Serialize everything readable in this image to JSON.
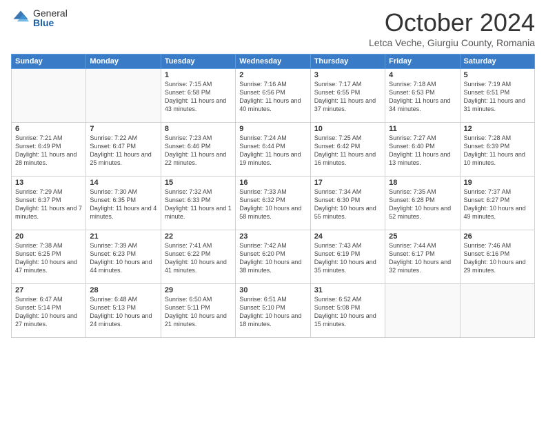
{
  "logo": {
    "general": "General",
    "blue": "Blue",
    "icon_color": "#1a5fa8"
  },
  "header": {
    "title": "October 2024",
    "location": "Letca Veche, Giurgiu County, Romania"
  },
  "weekdays": [
    "Sunday",
    "Monday",
    "Tuesday",
    "Wednesday",
    "Thursday",
    "Friday",
    "Saturday"
  ],
  "weeks": [
    [
      {
        "day": "",
        "sunrise": "",
        "sunset": "",
        "daylight": ""
      },
      {
        "day": "",
        "sunrise": "",
        "sunset": "",
        "daylight": ""
      },
      {
        "day": "1",
        "sunrise": "Sunrise: 7:15 AM",
        "sunset": "Sunset: 6:58 PM",
        "daylight": "Daylight: 11 hours and 43 minutes."
      },
      {
        "day": "2",
        "sunrise": "Sunrise: 7:16 AM",
        "sunset": "Sunset: 6:56 PM",
        "daylight": "Daylight: 11 hours and 40 minutes."
      },
      {
        "day": "3",
        "sunrise": "Sunrise: 7:17 AM",
        "sunset": "Sunset: 6:55 PM",
        "daylight": "Daylight: 11 hours and 37 minutes."
      },
      {
        "day": "4",
        "sunrise": "Sunrise: 7:18 AM",
        "sunset": "Sunset: 6:53 PM",
        "daylight": "Daylight: 11 hours and 34 minutes."
      },
      {
        "day": "5",
        "sunrise": "Sunrise: 7:19 AM",
        "sunset": "Sunset: 6:51 PM",
        "daylight": "Daylight: 11 hours and 31 minutes."
      }
    ],
    [
      {
        "day": "6",
        "sunrise": "Sunrise: 7:21 AM",
        "sunset": "Sunset: 6:49 PM",
        "daylight": "Daylight: 11 hours and 28 minutes."
      },
      {
        "day": "7",
        "sunrise": "Sunrise: 7:22 AM",
        "sunset": "Sunset: 6:47 PM",
        "daylight": "Daylight: 11 hours and 25 minutes."
      },
      {
        "day": "8",
        "sunrise": "Sunrise: 7:23 AM",
        "sunset": "Sunset: 6:46 PM",
        "daylight": "Daylight: 11 hours and 22 minutes."
      },
      {
        "day": "9",
        "sunrise": "Sunrise: 7:24 AM",
        "sunset": "Sunset: 6:44 PM",
        "daylight": "Daylight: 11 hours and 19 minutes."
      },
      {
        "day": "10",
        "sunrise": "Sunrise: 7:25 AM",
        "sunset": "Sunset: 6:42 PM",
        "daylight": "Daylight: 11 hours and 16 minutes."
      },
      {
        "day": "11",
        "sunrise": "Sunrise: 7:27 AM",
        "sunset": "Sunset: 6:40 PM",
        "daylight": "Daylight: 11 hours and 13 minutes."
      },
      {
        "day": "12",
        "sunrise": "Sunrise: 7:28 AM",
        "sunset": "Sunset: 6:39 PM",
        "daylight": "Daylight: 11 hours and 10 minutes."
      }
    ],
    [
      {
        "day": "13",
        "sunrise": "Sunrise: 7:29 AM",
        "sunset": "Sunset: 6:37 PM",
        "daylight": "Daylight: 11 hours and 7 minutes."
      },
      {
        "day": "14",
        "sunrise": "Sunrise: 7:30 AM",
        "sunset": "Sunset: 6:35 PM",
        "daylight": "Daylight: 11 hours and 4 minutes."
      },
      {
        "day": "15",
        "sunrise": "Sunrise: 7:32 AM",
        "sunset": "Sunset: 6:33 PM",
        "daylight": "Daylight: 11 hours and 1 minute."
      },
      {
        "day": "16",
        "sunrise": "Sunrise: 7:33 AM",
        "sunset": "Sunset: 6:32 PM",
        "daylight": "Daylight: 10 hours and 58 minutes."
      },
      {
        "day": "17",
        "sunrise": "Sunrise: 7:34 AM",
        "sunset": "Sunset: 6:30 PM",
        "daylight": "Daylight: 10 hours and 55 minutes."
      },
      {
        "day": "18",
        "sunrise": "Sunrise: 7:35 AM",
        "sunset": "Sunset: 6:28 PM",
        "daylight": "Daylight: 10 hours and 52 minutes."
      },
      {
        "day": "19",
        "sunrise": "Sunrise: 7:37 AM",
        "sunset": "Sunset: 6:27 PM",
        "daylight": "Daylight: 10 hours and 49 minutes."
      }
    ],
    [
      {
        "day": "20",
        "sunrise": "Sunrise: 7:38 AM",
        "sunset": "Sunset: 6:25 PM",
        "daylight": "Daylight: 10 hours and 47 minutes."
      },
      {
        "day": "21",
        "sunrise": "Sunrise: 7:39 AM",
        "sunset": "Sunset: 6:23 PM",
        "daylight": "Daylight: 10 hours and 44 minutes."
      },
      {
        "day": "22",
        "sunrise": "Sunrise: 7:41 AM",
        "sunset": "Sunset: 6:22 PM",
        "daylight": "Daylight: 10 hours and 41 minutes."
      },
      {
        "day": "23",
        "sunrise": "Sunrise: 7:42 AM",
        "sunset": "Sunset: 6:20 PM",
        "daylight": "Daylight: 10 hours and 38 minutes."
      },
      {
        "day": "24",
        "sunrise": "Sunrise: 7:43 AM",
        "sunset": "Sunset: 6:19 PM",
        "daylight": "Daylight: 10 hours and 35 minutes."
      },
      {
        "day": "25",
        "sunrise": "Sunrise: 7:44 AM",
        "sunset": "Sunset: 6:17 PM",
        "daylight": "Daylight: 10 hours and 32 minutes."
      },
      {
        "day": "26",
        "sunrise": "Sunrise: 7:46 AM",
        "sunset": "Sunset: 6:16 PM",
        "daylight": "Daylight: 10 hours and 29 minutes."
      }
    ],
    [
      {
        "day": "27",
        "sunrise": "Sunrise: 6:47 AM",
        "sunset": "Sunset: 5:14 PM",
        "daylight": "Daylight: 10 hours and 27 minutes."
      },
      {
        "day": "28",
        "sunrise": "Sunrise: 6:48 AM",
        "sunset": "Sunset: 5:13 PM",
        "daylight": "Daylight: 10 hours and 24 minutes."
      },
      {
        "day": "29",
        "sunrise": "Sunrise: 6:50 AM",
        "sunset": "Sunset: 5:11 PM",
        "daylight": "Daylight: 10 hours and 21 minutes."
      },
      {
        "day": "30",
        "sunrise": "Sunrise: 6:51 AM",
        "sunset": "Sunset: 5:10 PM",
        "daylight": "Daylight: 10 hours and 18 minutes."
      },
      {
        "day": "31",
        "sunrise": "Sunrise: 6:52 AM",
        "sunset": "Sunset: 5:08 PM",
        "daylight": "Daylight: 10 hours and 15 minutes."
      },
      {
        "day": "",
        "sunrise": "",
        "sunset": "",
        "daylight": ""
      },
      {
        "day": "",
        "sunrise": "",
        "sunset": "",
        "daylight": ""
      }
    ]
  ]
}
